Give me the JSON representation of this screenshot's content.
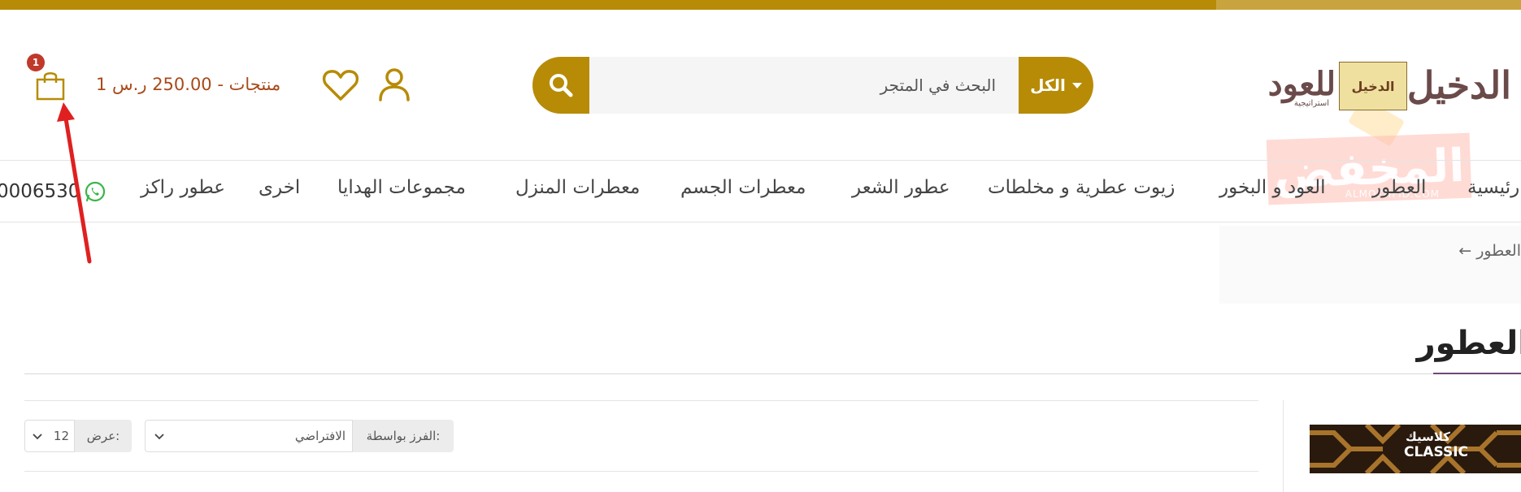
{
  "colors": {
    "accent": "#b78b06",
    "cart_text": "#a94a1a",
    "badge": "#c0392b",
    "arrow": "#e02020"
  },
  "logo": {
    "text_main": "الدخيل",
    "text_oud": "للعود",
    "badge_text": "الدخيل",
    "sub": "استراتيجية"
  },
  "watermark": {
    "text": "المخفض",
    "sub": "ALMOKHFID.COM"
  },
  "search": {
    "placeholder": "البحث في المتجر",
    "category": "الكل",
    "button_icon": "search-icon"
  },
  "header": {
    "cart_summary": "1 منتجات - 250.00 ر.س",
    "cart_count": "1"
  },
  "nav": {
    "items": [
      "رئيسية",
      "العطور",
      "العود و البخور",
      "زيوت عطرية و مخلطات",
      "عطور الشعر",
      "معطرات الجسم",
      "معطرات المنزل",
      "مجموعات الهدايا",
      "اخرى",
      "عطور راكز"
    ],
    "phone": "0006530"
  },
  "breadcrumb": {
    "text": "← العطور"
  },
  "page": {
    "title": "العطور"
  },
  "toolbar": {
    "sort_label": "الفرز بواسطة:",
    "sort_value": "الافتراضي",
    "show_label": "عرض:",
    "show_value": "12"
  },
  "product": {
    "label_ar": "كلاسيك",
    "label_en": "CLASSIC"
  }
}
